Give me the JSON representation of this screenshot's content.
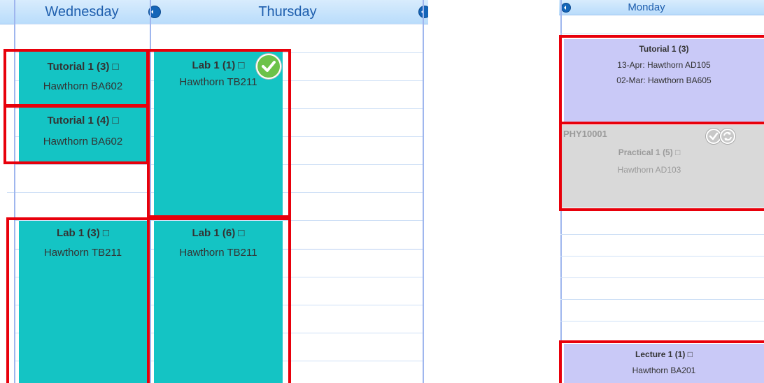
{
  "left_calendar": {
    "days": [
      "Wednesday",
      "Thursday"
    ],
    "events": [
      {
        "title": "Tutorial 1 (3) □",
        "location": "Hawthorn BA602"
      },
      {
        "title": "Tutorial 1 (4) □",
        "location": "Hawthorn BA602"
      },
      {
        "title": "Lab 1 (1) □",
        "location": "Hawthorn TB211"
      },
      {
        "title": "Lab 1 (3) □",
        "location": "Hawthorn TB211"
      },
      {
        "title": "Lab 1 (6) □",
        "location": "Hawthorn TB211"
      }
    ]
  },
  "right_calendar": {
    "day": "Monday",
    "events": [
      {
        "title": "Tutorial 1 (3)",
        "lines": [
          "13-Apr: Hawthorn AD105",
          "02-Mar: Hawthorn BA605"
        ]
      },
      {
        "code": "PHY10001",
        "title": "Practical 1 (5) □",
        "location": "Hawthorn AD103"
      },
      {
        "title": "Lecture 1 (1) □",
        "location": "Hawthorn BA201"
      }
    ]
  },
  "colors": {
    "teal_event": "#14c4c4",
    "lavender_event": "#c9c9f7",
    "grey_event": "#d9d9d9",
    "highlight_border": "#e8000b",
    "header": "#c9e3fc",
    "check_green": "#6cc24a"
  },
  "icons": [
    "nav-prev-icon",
    "nav-next-icon",
    "check-icon",
    "refresh-icon"
  ]
}
